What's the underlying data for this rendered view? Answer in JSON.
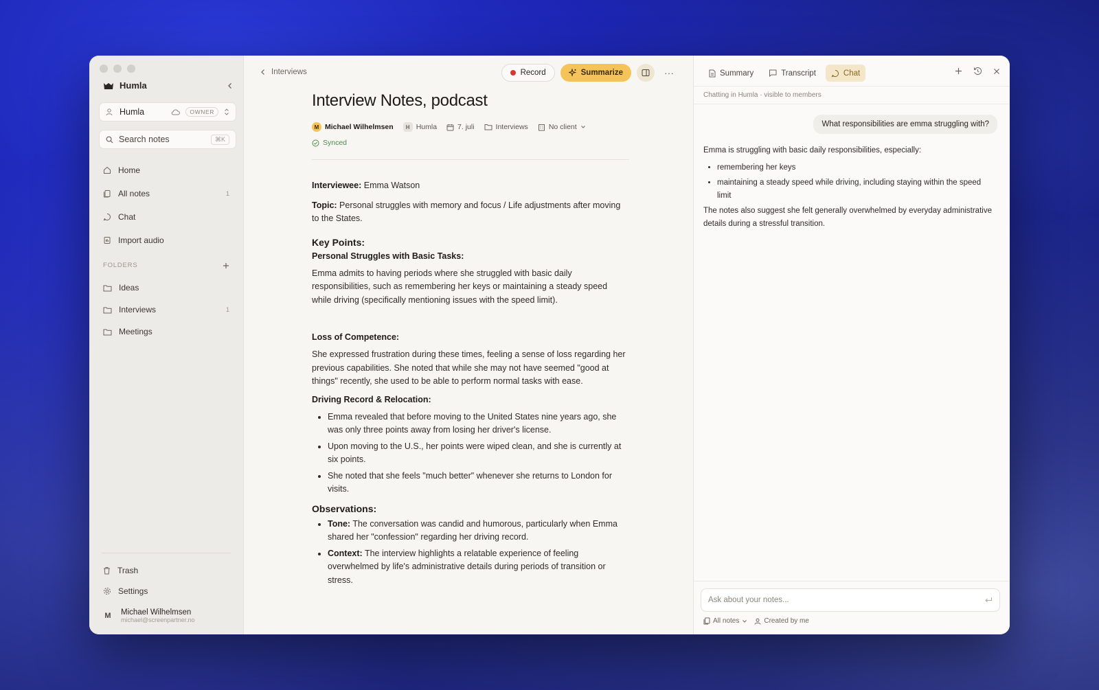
{
  "sidebar": {
    "workspace": "Humla",
    "team": {
      "name": "Humla",
      "role": "OWNER"
    },
    "search": {
      "placeholder": "Search notes",
      "shortcut": "⌘K"
    },
    "nav": [
      {
        "label": "Home",
        "count": ""
      },
      {
        "label": "All notes",
        "count": "1"
      },
      {
        "label": "Chat",
        "count": ""
      },
      {
        "label": "Import audio",
        "count": ""
      }
    ],
    "folders_heading": "FOLDERS",
    "folders": [
      {
        "label": "Ideas",
        "count": ""
      },
      {
        "label": "Interviews",
        "count": "1"
      },
      {
        "label": "Meetings",
        "count": ""
      }
    ],
    "trash": "Trash",
    "settings": "Settings",
    "user": {
      "initial": "M",
      "name": "Michael Wilhelmsen",
      "email": "michael@screenpartner.no"
    }
  },
  "main": {
    "breadcrumb": "Interviews",
    "toolbar": {
      "record": "Record",
      "summarize": "Summarize"
    },
    "title": "Interview Notes, podcast",
    "meta": {
      "author_initial": "M",
      "author": "Michael Wilhelmsen",
      "workspace_initial": "H",
      "workspace": "Humla",
      "date": "7. juli",
      "folder": "Interviews",
      "client": "No client"
    },
    "status": "Synced",
    "body": {
      "interviewee_label": "Interviewee:",
      "interviewee": " Emma Watson",
      "topic_label": "Topic:",
      "topic": " Personal struggles with memory and focus / Life adjustments after moving to the States.",
      "key_points": "Key Points:",
      "s1_title": "Personal Struggles with Basic Tasks:",
      "s1_text": "Emma admits to having periods where she struggled with basic daily responsibilities, such as remembering her keys or maintaining a steady speed while driving (specifically mentioning issues with the speed limit).",
      "s2_title": "Loss of Competence:",
      "s2_text": "She expressed frustration during these times, feeling a sense of loss regarding her previous capabilities. She noted that while she may not have seemed \"good at things\" recently, she used to be able to perform normal tasks with ease.",
      "s3_title": "Driving Record & Relocation:",
      "s3_items": [
        "Emma revealed that before moving to the United States nine years ago, she was only three points away from losing her driver's license.",
        "Upon moving to the U.S., her points were wiped clean, and she is currently at six points.",
        "She noted that she feels \"much better\" whenever she returns to London for visits."
      ],
      "observations": "Observations:",
      "obs_items": [
        {
          "label": "Tone:",
          "text": " The conversation was candid and humorous, particularly when Emma shared her \"confession\" regarding her driving record."
        },
        {
          "label": "Context:",
          "text": " The interview highlights a relatable experience of feeling overwhelmed by life's administrative details during periods of transition or stress."
        }
      ]
    }
  },
  "panel": {
    "tabs": [
      "Summary",
      "Transcript",
      "Chat"
    ],
    "active_tab": "Chat",
    "subheader": "Chatting in Humla · visible to members",
    "user_message": "What responsibilities are emma struggling with?",
    "answer_intro": "Emma is struggling with basic daily responsibilities, especially:",
    "answer_items": [
      "remembering her keys",
      "maintaining a steady speed while driving, including staying within the speed limit"
    ],
    "answer_outro": "The notes also suggest she felt generally overwhelmed by everyday administrative details during a stressful transition.",
    "input_placeholder": "Ask about your notes...",
    "filter_scope": "All notes",
    "filter_owner": "Created by me"
  },
  "colors": {
    "accent": "#f4c45a",
    "record": "#d63a2f",
    "synced": "#4f8a4a",
    "active_tab_bg": "#f4e7c9"
  }
}
